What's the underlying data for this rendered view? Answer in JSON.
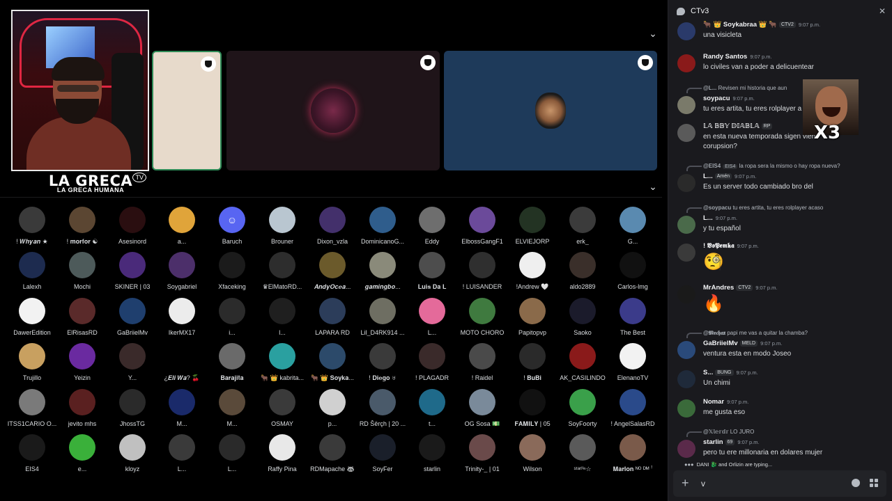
{
  "chat": {
    "title": "CTv3",
    "input_value": "v",
    "typing": "DANI 🐉 and Orlizin are typing...",
    "messages": [
      {
        "user": "🐂 👑 Soykabraa 👑 🐂",
        "tag": "CTV2",
        "time": "9:07 p.m.",
        "text": "una visicleta"
      },
      {
        "user": "Randy Santos",
        "time": "9:07 p.m.",
        "text": "lo civiles van a poder a delicuentear"
      },
      {
        "reply_user": "@L...",
        "reply_text": "Revisen mi historia que aun",
        "user": "soypacu",
        "time": "9:07 p.m.",
        "text": "tu eres artita, tu eres rolplayer a"
      },
      {
        "user": "𝕃𝔸 𝔹𝔹𝕐 𝔻𝕀𝔸𝔹𝕃𝔸",
        "tag": "RP",
        "time": "",
        "text": "en esta nueva temporada sigen vien",
        "text2": "corupsion?"
      },
      {
        "reply_user": "@EIS4",
        "reply_tag": "EIS4",
        "reply_text": "la ropa sera la mismo o hay ropa nueva?",
        "user": "L...",
        "tag": "Amén",
        "time": "9:07 p.m.",
        "text": "Es un server todo cambiado bro del"
      },
      {
        "reply_user": "@soypacu",
        "reply_text": "tu eres artita, tu eres rolplayer acaso",
        "user": "L...",
        "time": "9:07 p.m.",
        "text": "y tu español"
      },
      {
        "user": "! 𝖁𝖔𝕻𝖊𝖒𝖐𝖆",
        "time": "9:07 p.m.",
        "emoji": "🧐"
      },
      {
        "user": "MrAndres",
        "tag": "CTV2",
        "time": "9:07 p.m.",
        "emoji": "🔥"
      },
      {
        "reply_user": "@𝕸𝖊𝖈𝖍𝖆𝖝",
        "reply_text": "papi me vas a quitar la chamba?",
        "user": "GaBriielMv",
        "tag": "MELD",
        "time": "9:07 p.m.",
        "text": "ventura esta en modo Joseo"
      },
      {
        "user": "S...",
        "tag": "BUNG",
        "time": "9:07 p.m.",
        "text": "Un chimi"
      },
      {
        "user": "Nomar",
        "time": "9:07 p.m.",
        "text": "me gusta eso"
      },
      {
        "reply_user": "@𝕏𝕝𝕖𝕣𝕕𝕣",
        "reply_text": "LO JURO",
        "user": "starlin",
        "tag": "69",
        "time": "9:07 p.m.",
        "text": "pero tu ere millonaria en dolares mujer"
      }
    ]
  },
  "stream": {
    "brand_title": "LA GRECA",
    "brand_sub": "LA GRECA HUMANA",
    "brand_tv": "TV"
  },
  "participants": [
    {
      "name": "! 𝑾𝒉𝒚𝒂𝒏 ★",
      "color": "#3a3a3a"
    },
    {
      "name": "! 𝐦𝐨𝐫𝐟𝐨𝐫 ☯",
      "color": "#5b4632"
    },
    {
      "name": "Asesinord",
      "color": "#2a0e10"
    },
    {
      "name": "a...",
      "color": "#e0a43a"
    },
    {
      "name": "Baruch",
      "color": "#5865f2",
      "icon": "discord"
    },
    {
      "name": "Brouner",
      "color": "#b9c6d0"
    },
    {
      "name": "Dixon_vzla",
      "color": "#43306b"
    },
    {
      "name": "DominicanoG...",
      "color": "#2f5d8c"
    },
    {
      "name": "Eddy",
      "color": "#6e6e6e"
    },
    {
      "name": "ElbossGangF1",
      "color": "#6b4a9a"
    },
    {
      "name": "ELVIEJORP",
      "color": "#233323"
    },
    {
      "name": "erk_",
      "color": "#3b3b3b"
    },
    {
      "name": "G...",
      "color": "#5a8ab0"
    },
    {
      "name": "Lalexh",
      "color": "#1d2b4f"
    },
    {
      "name": "Mochi",
      "color": "#4d5a5a"
    },
    {
      "name": "SKINER | 03",
      "color": "#4a2a7a"
    },
    {
      "name": "Soygabriel",
      "color": "#4c2f6a"
    },
    {
      "name": "Xfaceking",
      "color": "#1b1b1b"
    },
    {
      "name": "♛ElMatoRD...",
      "color": "#2d2d2d"
    },
    {
      "name": "𝑨𝒏𝒅𝒚𝑶𝒄𝒆𝒂...",
      "color": "#6b5a2b"
    },
    {
      "name": "𝒈𝒂𝒎𝒊𝒏𝒈𝒃𝒐...",
      "color": "#8a8a7a"
    },
    {
      "name": "𝐋𝐮𝐢𝐬 𝐃𝐚 𝐋",
      "color": "#4d4d4d"
    },
    {
      "name": "! LUISANDER",
      "color": "#2f2f2f"
    },
    {
      "name": "!Andrew 🤍",
      "color": "#efefef"
    },
    {
      "name": "aldo2889",
      "color": "#3a2f2a"
    },
    {
      "name": "Carlos-lmg",
      "color": "#111111"
    },
    {
      "name": "DawerEdition",
      "color": "#f2f2f2"
    },
    {
      "name": "ElRisasRD",
      "color": "#5a2a2a"
    },
    {
      "name": "GaBriielMv",
      "color": "#1f3f6e"
    },
    {
      "name": "IkerMX17",
      "color": "#ececec"
    },
    {
      "name": "i...",
      "color": "#2b2b2b"
    },
    {
      "name": "l...",
      "color": "#1f1f1f"
    },
    {
      "name": "LAPARA RD",
      "color": "#2c3d5a"
    },
    {
      "name": "Lil_D4RK914 ...",
      "color": "#6e6e62"
    },
    {
      "name": "L...",
      "color": "#e46a9a"
    },
    {
      "name": "MOTO CHORO",
      "color": "#3f7a3f"
    },
    {
      "name": "Papitopvp",
      "color": "#8a6a4a"
    },
    {
      "name": "Saoko",
      "color": "#1b1b2b"
    },
    {
      "name": "The Best",
      "color": "#3b3b8a"
    },
    {
      "name": "Trujillo",
      "color": "#c8a060"
    },
    {
      "name": "Yeizin",
      "color": "#6a2aa0"
    },
    {
      "name": "Y...",
      "color": "#3a2a2a"
    },
    {
      "name": "¿𝑬𝒍𝒊 𝑾𝒂? 🍒",
      "color": "#000000"
    },
    {
      "name": "𝐁𝐚𝐫𝐚𝐣𝐢𝐭𝐚",
      "color": "#6a6a6a"
    },
    {
      "name": "🐂 👑 kabrita...",
      "color": "#2aa0a0"
    },
    {
      "name": "🐂 👑 𝐒𝐨𝐲𝐤𝐚...",
      "color": "#2c4a6a"
    },
    {
      "name": "! 𝐃𝐢𝐞𝐠𝐨 ♅",
      "color": "#3a3a3a"
    },
    {
      "name": "! PLAGADR",
      "color": "#3a2a2a"
    },
    {
      "name": "! Raidel",
      "color": "#4a4a4a"
    },
    {
      "name": "! 𝐁𝐮𝐁𝐢",
      "color": "#2a2a2a"
    },
    {
      "name": "AK_CASILINDO",
      "color": "#8a1a1a"
    },
    {
      "name": "ElenanoTV",
      "color": "#f2f2f2"
    },
    {
      "name": "ITSS1CARIO O...",
      "color": "#7a7a7a"
    },
    {
      "name": "jevito mhs",
      "color": "#5a2020"
    },
    {
      "name": "JhossTG",
      "color": "#2a2a2a"
    },
    {
      "name": "M...",
      "color": "#1a2a6a"
    },
    {
      "name": "M...",
      "color": "#5a4a3a"
    },
    {
      "name": "OSMAY",
      "color": "#3a3a3a"
    },
    {
      "name": "p...",
      "color": "#d0d0d0"
    },
    {
      "name": "RD Šërçh | 20 ...",
      "color": "#4a5a6a"
    },
    {
      "name": "t...",
      "color": "#1f6a8a"
    },
    {
      "name": "OG Sosa 💵",
      "color": "#7a8a9a"
    },
    {
      "name": "𝐅𝐀𝐌𝐈𝐋𝐘 | 05",
      "color": "#111111"
    },
    {
      "name": "SoyFoorty",
      "color": "#3aa04a"
    },
    {
      "name": "! AngelSalasRD",
      "color": "#2a4a8a"
    },
    {
      "name": "EIS4",
      "color": "#1a1a1a"
    },
    {
      "name": "e...",
      "color": "#3ab03a"
    },
    {
      "name": "kloyz",
      "color": "#c0c0c0"
    },
    {
      "name": "L...",
      "color": "#3a3a3a"
    },
    {
      "name": "L...",
      "color": "#2a2a2a"
    },
    {
      "name": "Raffy Pina",
      "color": "#e8e8e8"
    },
    {
      "name": "RDMapache 🦝",
      "color": "#3a3a3a"
    },
    {
      "name": "SoyFer",
      "color": "#1a1f2a"
    },
    {
      "name": "starlin",
      "color": "#1a1a1a"
    },
    {
      "name": "Trinity-_ | 01",
      "color": "#6a4a4a"
    },
    {
      "name": "Wilson",
      "color": "#8a6a5a"
    },
    {
      "name": "ˢᵗᵃʳˡⁱⁿ☆",
      "color": "#5a5a5a"
    },
    {
      "name": "𝐌𝐚𝐫𝐥𝐨𝐧 ᴺᴼ ᴰᴹ ꜝ",
      "color": "#7a5a4a"
    }
  ],
  "colors": {
    "background": "#000000",
    "chat_panel": "#1a1a1e",
    "tile_beige": "#e7dacb",
    "tile_dark": "#1f1419",
    "tile_blue": "#1e3a5a",
    "tile_border": "#2e8b57"
  },
  "icons": [
    "chevron-down-icon",
    "shield-icon",
    "close-icon",
    "plus-icon",
    "emoji-icon",
    "apps-icon",
    "chat-bubble-icon"
  ]
}
